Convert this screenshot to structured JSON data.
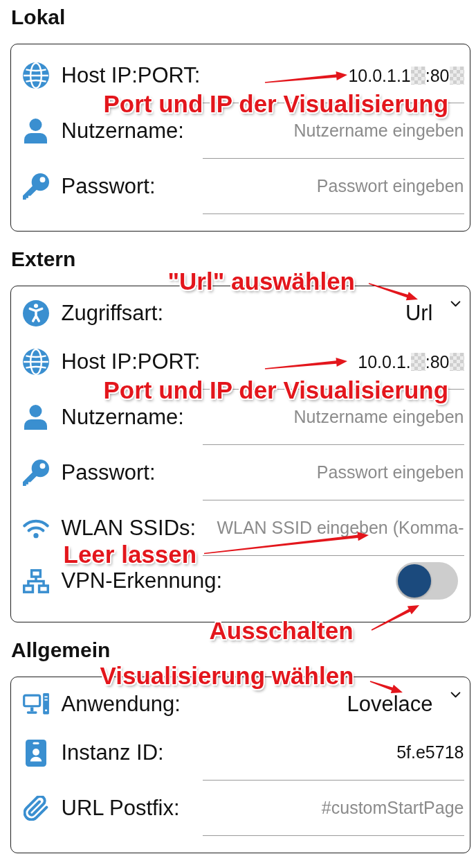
{
  "sections": [
    {
      "title": "Lokal",
      "rows": [
        {
          "kind": "host",
          "label": "Host IP:PORT:",
          "value_segments": [
            "10.0.1.1",
            ":80"
          ],
          "annotation": "Port und IP der Visualisierung"
        },
        {
          "kind": "user",
          "label": "Nutzername:",
          "placeholder": "Nutzername eingeben"
        },
        {
          "kind": "password",
          "label": "Passwort:",
          "placeholder": "Passwort eingeben"
        }
      ]
    },
    {
      "title": "Extern",
      "rows": [
        {
          "kind": "access",
          "label": "Zugriffsart:",
          "value": "Url",
          "annotation": "\"Url\" auswählen"
        },
        {
          "kind": "host",
          "label": "Host IP:PORT:",
          "value_segments": [
            "10.0.1.",
            ":80"
          ],
          "annotation": "Port und IP der Visualisierung"
        },
        {
          "kind": "user",
          "label": "Nutzername:",
          "placeholder": "Nutzername eingeben"
        },
        {
          "kind": "password",
          "label": "Passwort:",
          "placeholder": "Passwort eingeben"
        },
        {
          "kind": "ssid",
          "label": "WLAN SSIDs:",
          "placeholder": "WLAN SSID eingeben (Komma-",
          "annotation": "Leer lassen"
        },
        {
          "kind": "vpn",
          "label": "VPN-Erkennung:",
          "on": false,
          "annotation": "Ausschalten"
        }
      ]
    },
    {
      "title": "Allgemein",
      "rows": [
        {
          "kind": "app",
          "label": "Anwendung:",
          "value": "Lovelace",
          "annotation": "Visualisierung wählen"
        },
        {
          "kind": "instance",
          "label": "Instanz ID:",
          "value": "5f.e5718"
        },
        {
          "kind": "postfix",
          "label": "URL Postfix:",
          "placeholder": "#customStartPage"
        }
      ]
    }
  ]
}
